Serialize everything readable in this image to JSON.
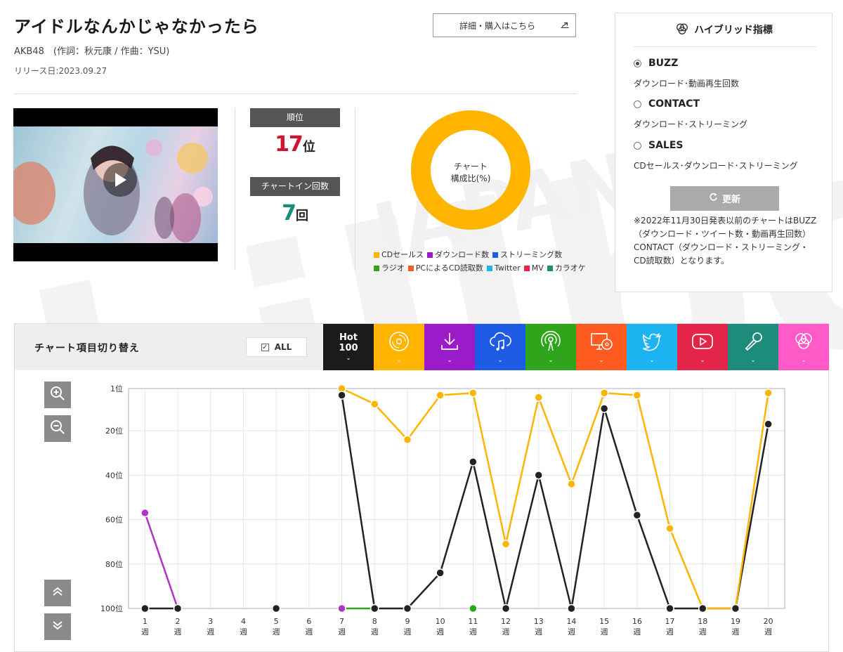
{
  "song": {
    "title": "アイドルなんかじゃなかったら",
    "artist": "AKB48　(作詞：秋元康 / 作曲：YSU)",
    "release": "リリース日:2023.09.27"
  },
  "buy_button": {
    "label": "詳細・購入はこちら",
    "icon": "arrow-diagonal-icon"
  },
  "stats": {
    "rank_label": "順位",
    "rank_value": "17",
    "rank_unit": "位",
    "chartin_label": "チャートイン回数",
    "chartin_value": "7",
    "chartin_unit": "回"
  },
  "donut": {
    "center_line1": "チャート",
    "center_line2": "構成比(%)",
    "color": "#FFB400",
    "legend": [
      {
        "label": "CDセールス",
        "color": "#FFB400"
      },
      {
        "label": "ダウンロード数",
        "color": "#9B1BC8"
      },
      {
        "label": "ストリーミング数",
        "color": "#1F5CE6"
      },
      {
        "label": "ラジオ",
        "color": "#2EA51A"
      },
      {
        "label": "PCによるCD読取数",
        "color": "#FF5A1F"
      },
      {
        "label": "Twitter",
        "color": "#1BB4F0"
      },
      {
        "label": "MV",
        "color": "#E5244A"
      },
      {
        "label": "カラオケ",
        "color": "#1E8C7A"
      }
    ]
  },
  "hybrid": {
    "title": "ハイブリッド指標",
    "options": [
      {
        "label": "BUZZ",
        "desc": "ダウンロード･動画再生回数",
        "selected": true
      },
      {
        "label": "CONTACT",
        "desc": "ダウンロード･ストリーミング",
        "selected": false
      },
      {
        "label": "SALES",
        "desc": "CDセールス･ダウンロード･ストリーミング",
        "selected": false
      }
    ],
    "update_label": "更新",
    "note": "※2022年11月30日発表以前のチャートはBUZZ（ダウンロード・ツイート数・動画再生回数）CONTACT（ダウンロード・ストリーミング・CD読取数）となります。"
  },
  "chart_panel": {
    "title": "チャート項目切り替え",
    "all_label": "ALL",
    "tabs": [
      {
        "label_top": "Hot",
        "label_bottom": "100",
        "color": "#1c1a1a",
        "icon": "hot100"
      },
      {
        "color": "#FFB400",
        "icon": "cd-icon"
      },
      {
        "color": "#9B1BC8",
        "icon": "download-icon"
      },
      {
        "color": "#1F5CE6",
        "icon": "cloud-music-icon"
      },
      {
        "color": "#2EA51A",
        "icon": "radio-icon"
      },
      {
        "color": "#FF5A1F",
        "icon": "pc-cd-icon"
      },
      {
        "color": "#1BB4F0",
        "icon": "twitter-icon"
      },
      {
        "color": "#E5244A",
        "icon": "youtube-icon"
      },
      {
        "color": "#1E8C7A",
        "icon": "microphone-icon"
      },
      {
        "color": "#FF5AC8",
        "icon": "hybrid-icon"
      }
    ]
  },
  "chart_data": {
    "type": "line",
    "x": [
      1,
      2,
      3,
      4,
      5,
      6,
      7,
      8,
      9,
      10,
      11,
      12,
      13,
      14,
      15,
      16,
      17,
      18,
      19,
      20
    ],
    "x_tick_labels": [
      "1\n週",
      "2\n週",
      "3\n週",
      "4\n週",
      "5\n週",
      "6\n週",
      "7\n週",
      "8\n週",
      "9\n週",
      "10\n週",
      "11\n週",
      "12\n週",
      "13\n週",
      "14\n週",
      "15\n週",
      "16\n週",
      "17\n週",
      "18\n週",
      "19\n週",
      "20\n週"
    ],
    "y_tick_labels": [
      "1位",
      "20位",
      "40位",
      "60位",
      "80位",
      "100位"
    ],
    "y_ticks": [
      1,
      20,
      40,
      60,
      80,
      100
    ],
    "ylim": [
      1,
      100
    ],
    "y_inverted": true,
    "grid": true,
    "series": [
      {
        "key": "hot100",
        "color": "#222222",
        "points": [
          [
            1,
            100
          ],
          [
            2,
            100
          ],
          [
            5,
            100
          ],
          [
            7,
            4
          ],
          [
            8,
            100
          ],
          [
            9,
            100
          ],
          [
            10,
            84
          ],
          [
            11,
            34
          ],
          [
            12,
            100
          ],
          [
            13,
            40
          ],
          [
            14,
            100
          ],
          [
            15,
            10
          ],
          [
            16,
            58
          ],
          [
            17,
            100
          ],
          [
            18,
            100
          ],
          [
            19,
            100
          ],
          [
            20,
            17
          ]
        ],
        "segments": [
          [
            1,
            2
          ],
          [
            7,
            8,
            9,
            10,
            11,
            12,
            13,
            14,
            15,
            16,
            17,
            18,
            19,
            20
          ]
        ]
      },
      {
        "key": "cd",
        "color": "#FFB400",
        "points": [
          [
            7,
            1
          ],
          [
            8,
            8
          ],
          [
            9,
            24
          ],
          [
            10,
            4
          ],
          [
            11,
            3
          ],
          [
            12,
            71
          ],
          [
            13,
            5
          ],
          [
            14,
            44
          ],
          [
            15,
            3
          ],
          [
            16,
            4
          ],
          [
            17,
            64
          ],
          [
            18,
            100
          ],
          [
            19,
            100
          ],
          [
            20,
            3
          ]
        ],
        "segments": [
          [
            7,
            8,
            9,
            10,
            11,
            12,
            13,
            14,
            15,
            16,
            17,
            18,
            19,
            20
          ]
        ]
      },
      {
        "key": "download",
        "color": "#B232C8",
        "points": [
          [
            1,
            57
          ],
          [
            2,
            100
          ],
          [
            7,
            100
          ]
        ],
        "segments": [
          [
            1,
            2
          ]
        ]
      },
      {
        "key": "radio",
        "color": "#2EA51A",
        "points": [
          [
            8,
            100
          ],
          [
            11,
            100
          ]
        ],
        "segments": [
          [
            7,
            8
          ]
        ]
      }
    ]
  }
}
